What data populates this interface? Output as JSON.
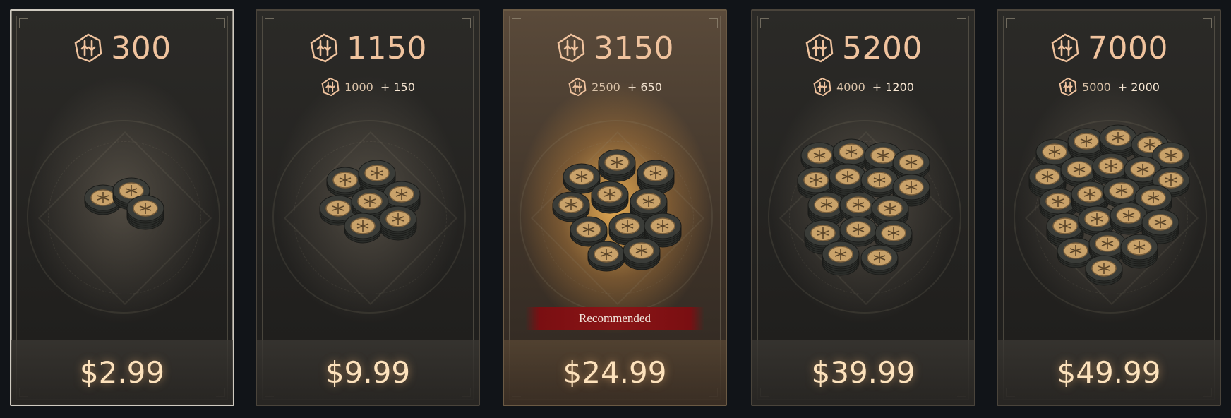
{
  "store": {
    "packs": [
      {
        "amount": "300",
        "base": "",
        "bonus": "",
        "price": "$2.99",
        "badge": "",
        "coins": 3
      },
      {
        "amount": "1150",
        "base": "1000",
        "bonus": "+ 150",
        "price": "$9.99",
        "badge": "",
        "coins": 7
      },
      {
        "amount": "3150",
        "base": "2500",
        "bonus": "+ 650",
        "price": "$24.99",
        "badge": "Recommended",
        "coins": 11
      },
      {
        "amount": "5200",
        "base": "4000",
        "bonus": "+ 1200",
        "price": "$39.99",
        "badge": "",
        "coins": 16
      },
      {
        "amount": "7000",
        "base": "5000",
        "bonus": "+ 2000",
        "price": "$49.99",
        "badge": "",
        "coins": 22
      }
    ],
    "selected_index": 0,
    "featured_index": 2,
    "currency_icon": "platinum-coin-icon",
    "colors": {
      "amount_text": "#f0c39e",
      "price_text": "#fde2bc",
      "badge_bg": "#8a1416",
      "coin_face": "#c9a26a",
      "coin_rim": "#3a3c38"
    }
  }
}
